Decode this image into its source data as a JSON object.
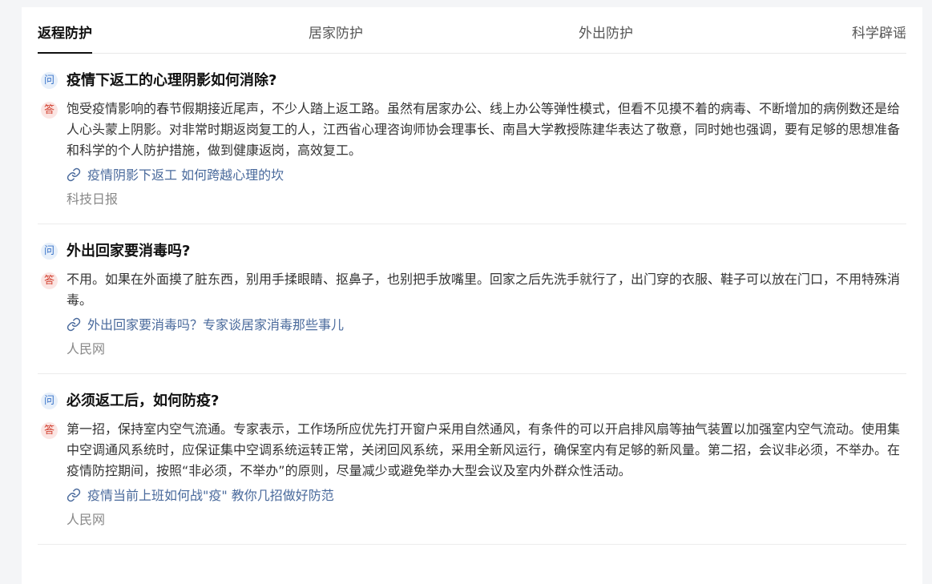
{
  "tabs": [
    {
      "label": "返程防护",
      "active": true
    },
    {
      "label": "居家防护",
      "active": false
    },
    {
      "label": "外出防护",
      "active": false
    },
    {
      "label": "科学辟谣",
      "active": false
    }
  ],
  "badges": {
    "question": "问",
    "answer": "答"
  },
  "items": [
    {
      "question": "疫情下返工的心理阴影如何消除?",
      "answer": "饱受疫情影响的春节假期接近尾声，不少人踏上返工路。虽然有居家办公、线上办公等弹性模式，但看不见摸不着的病毒、不断增加的病例数还是给人心头蒙上阴影。对非常时期返岗复工的人，江西省心理咨询师协会理事长、南昌大学教授陈建华表达了敬意，同时她也强调，要有足够的思想准备和科学的个人防护措施，做到健康返岗，高效复工。",
      "link": "疫情阴影下返工 如何跨越心理的坎",
      "source": "科技日报"
    },
    {
      "question": "外出回家要消毒吗?",
      "answer": "不用。如果在外面摸了脏东西，别用手揉眼睛、抠鼻子，也别把手放嘴里。回家之后先洗手就行了，出门穿的衣服、鞋子可以放在门口，不用特殊消毒。",
      "link": "外出回家要消毒吗？专家谈居家消毒那些事儿",
      "source": "人民网"
    },
    {
      "question": "必须返工后，如何防疫?",
      "answer": "第一招，保持室内空气流通。专家表示，工作场所应优先打开窗户采用自然通风，有条件的可以开启排风扇等抽气装置以加强室内空气流动。使用集中空调通风系统时，应保证集中空调系统运转正常，关闭回风系统，采用全新风运行，确保室内有足够的新风量。第二招，会议非必须，不举办。在疫情防控期间，按照“非必须，不举办”的原则，尽量减少或避免举办大型会议及室内外群众性活动。",
      "link": "疫情当前上班如何战\"疫\" 教你几招做好防范",
      "source": "人民网"
    }
  ]
}
